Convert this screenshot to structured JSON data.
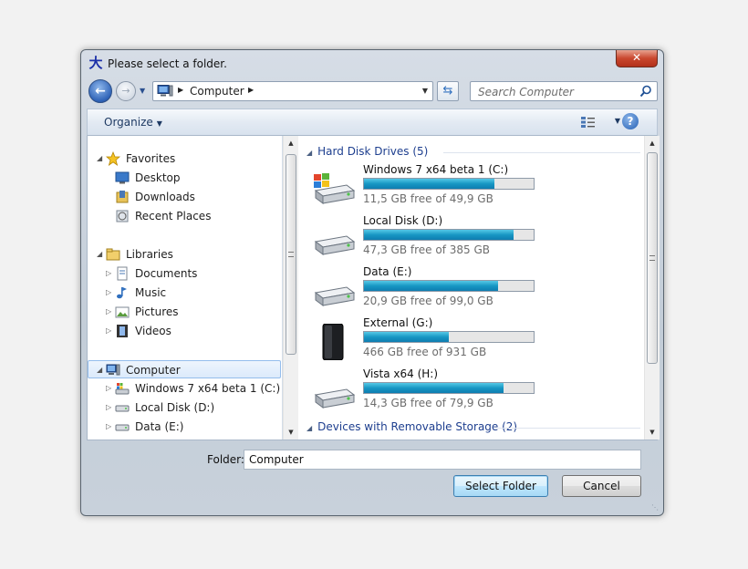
{
  "window": {
    "title": "Please select a folder.",
    "title_glyph": "大",
    "close_glyph": "✕"
  },
  "address": {
    "crumb": "Computer"
  },
  "search": {
    "placeholder": "Search Computer"
  },
  "toolbar": {
    "organize_label": "Organize",
    "help_glyph": "?"
  },
  "nav": {
    "favorites": {
      "label": "Favorites",
      "items": [
        {
          "label": "Desktop",
          "icon": "desktop-icon"
        },
        {
          "label": "Downloads",
          "icon": "downloads-icon"
        },
        {
          "label": "Recent Places",
          "icon": "recent-places-icon"
        }
      ]
    },
    "libraries": {
      "label": "Libraries",
      "items": [
        {
          "label": "Documents",
          "icon": "documents-icon"
        },
        {
          "label": "Music",
          "icon": "music-icon"
        },
        {
          "label": "Pictures",
          "icon": "pictures-icon"
        },
        {
          "label": "Videos",
          "icon": "videos-icon"
        }
      ]
    },
    "computer": {
      "label": "Computer",
      "items": [
        {
          "label": "Windows 7 x64 beta 1 (C:)",
          "icon": "windows-drive-icon"
        },
        {
          "label": "Local Disk (D:)",
          "icon": "hard-drive-icon"
        },
        {
          "label": "Data (E:)",
          "icon": "hard-drive-icon"
        }
      ]
    }
  },
  "files": {
    "group_hdd": "Hard Disk Drives (5)",
    "group_removable": "Devices with Removable Storage (2)",
    "drives": [
      {
        "name": "Windows 7 x64 beta 1 (C:)",
        "free": "11,5 GB free of 49,9 GB",
        "used_fraction": 0.77,
        "icon": "windows-drive-icon"
      },
      {
        "name": "Local Disk (D:)",
        "free": "47,3 GB free of 385 GB",
        "used_fraction": 0.88,
        "icon": "hard-drive-icon"
      },
      {
        "name": "Data (E:)",
        "free": "20,9 GB free of 99,0 GB",
        "used_fraction": 0.79,
        "icon": "hard-drive-icon"
      },
      {
        "name": "External (G:)",
        "free": "466 GB free of 931 GB",
        "used_fraction": 0.5,
        "icon": "external-drive-icon"
      },
      {
        "name": "Vista x64 (H:)",
        "free": "14,3 GB free of 79,9 GB",
        "used_fraction": 0.82,
        "icon": "hard-drive-icon"
      }
    ]
  },
  "footer": {
    "folder_label": "Folder:",
    "folder_value": "Computer",
    "select_button": "Select Folder",
    "cancel_button": "Cancel"
  },
  "colors": {
    "bar_fill": "#1897c4",
    "group_header": "#1e3f8f",
    "selection": "#dceafb"
  }
}
